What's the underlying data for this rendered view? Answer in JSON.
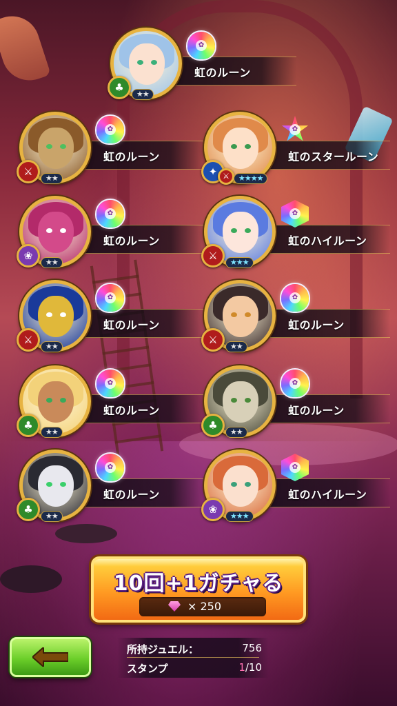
{
  "rune_label": "虹のルーン",
  "cards": [
    {
      "label": "虹のルーン",
      "rune": "rainbow-rune",
      "stars": "★★",
      "role": "green",
      "hair": "#9fc3e8",
      "skin": "#fbe1d0",
      "eyes": "#3ab07a"
    },
    {
      "label": "虹のルーン",
      "rune": "rainbow-rune",
      "stars": "★★",
      "role": "red",
      "hair": "#8a5a2a",
      "skin": "#c9a46a",
      "eyes": "#4fbf5f"
    },
    {
      "label": "虹のスタールーン",
      "rune": "rainbow-star-rune",
      "stars": "★★★★",
      "role": "blue",
      "hair": "#e08a4a",
      "skin": "#fde0c8",
      "eyes": "#3a9a50"
    },
    {
      "label": "虹のルーン",
      "rune": "rainbow-rune",
      "stars": "★★",
      "role": "purple",
      "hair": "#b32a6a",
      "skin": "#d34a8a",
      "eyes": "#ffffff"
    },
    {
      "label": "虹のハイルーン",
      "rune": "rainbow-high-rune",
      "stars": "★★★",
      "role": "red",
      "hair": "#5a7be0",
      "skin": "#fde6dc",
      "eyes": "#3aaa5a"
    },
    {
      "label": "虹のルーン",
      "rune": "rainbow-rune",
      "stars": "★★",
      "role": "red",
      "hair": "#1a3a9a",
      "skin": "#e0b83a",
      "eyes": "#ffffff"
    },
    {
      "label": "虹のルーン",
      "rune": "rainbow-rune",
      "stars": "★★",
      "role": "red",
      "hair": "#3a2a2a",
      "skin": "#f3c9a2",
      "eyes": "#d08a2a"
    },
    {
      "label": "虹のルーン",
      "rune": "rainbow-rune",
      "stars": "★★",
      "role": "green",
      "hair": "#f3d27a",
      "skin": "#c98a5a",
      "eyes": "#3aaa5a"
    },
    {
      "label": "虹のルーン",
      "rune": "rainbow-rune",
      "stars": "★★",
      "role": "green",
      "hair": "#4a4a3a",
      "skin": "#d8d0b8",
      "eyes": "#4a8a3a"
    },
    {
      "label": "虹のルーン",
      "rune": "rainbow-rune",
      "stars": "★★",
      "role": "green",
      "hair": "#2a2a32",
      "skin": "#e8e8ee",
      "eyes": "#3acf6a"
    },
    {
      "label": "虹のハイルーン",
      "rune": "rainbow-high-rune",
      "stars": "★★★",
      "role": "purple",
      "hair": "#d96a3a",
      "skin": "#fbe0ce",
      "eyes": "#3aa07a"
    }
  ],
  "gacha": {
    "title": "10回+1ガチャる",
    "cost_prefix": "× 250",
    "icon": "gem-icon"
  },
  "footer": {
    "jewel_label": "所持ジュエル：",
    "jewel_value": "756",
    "stamp_label": "スタンプ",
    "stamp_current": "1",
    "stamp_total": "/10"
  },
  "back_button": {
    "icon": "arrow-left-icon"
  },
  "colors": {
    "frame_gold": "#e7b341",
    "role_green": "#2f8a2a",
    "role_red": "#b01c1c",
    "role_blue": "#1c4fb0",
    "role_purple": "#7a3ab0"
  }
}
